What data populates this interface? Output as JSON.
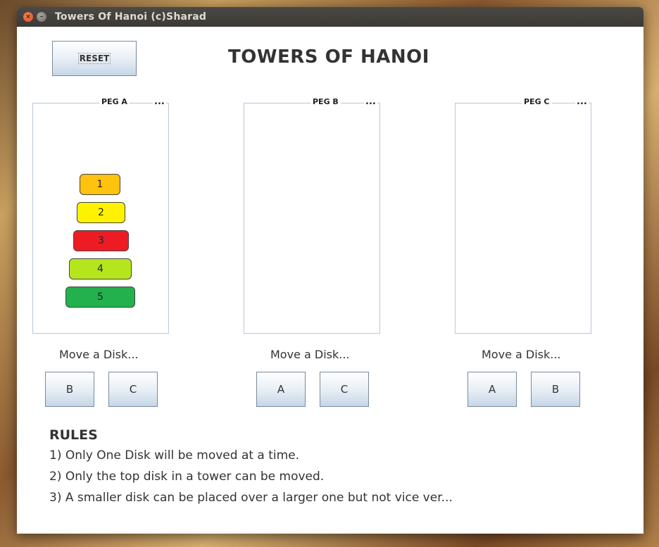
{
  "window": {
    "title": "Towers Of Hanoi (c)Sharad",
    "close_glyph": "×",
    "min_glyph": "–"
  },
  "toolbar": {
    "reset_label": "RESET"
  },
  "app_title": "TOWERS OF HANOI",
  "pegs": [
    {
      "label": "PEG A",
      "dots": "...",
      "move_label": "Move a Disk...",
      "buttons": [
        "B",
        "C"
      ]
    },
    {
      "label": "PEG B",
      "dots": "...",
      "move_label": "Move a Disk...",
      "buttons": [
        "A",
        "C"
      ]
    },
    {
      "label": "PEG C",
      "dots": "...",
      "move_label": "Move a Disk...",
      "buttons": [
        "A",
        "B"
      ]
    }
  ],
  "disks": [
    {
      "label": "1",
      "color": "#ffc20e"
    },
    {
      "label": "2",
      "color": "#fff200"
    },
    {
      "label": "3",
      "color": "#ed1c24"
    },
    {
      "label": "4",
      "color": "#b5e61d"
    },
    {
      "label": "5",
      "color": "#22b14c"
    }
  ],
  "rules": {
    "heading": "RULES",
    "items": [
      "1) Only One Disk will be moved at a time.",
      "2) Only the top disk in a tower can be moved.",
      "3) A smaller disk can be placed over a larger one but not vice ver..."
    ]
  }
}
